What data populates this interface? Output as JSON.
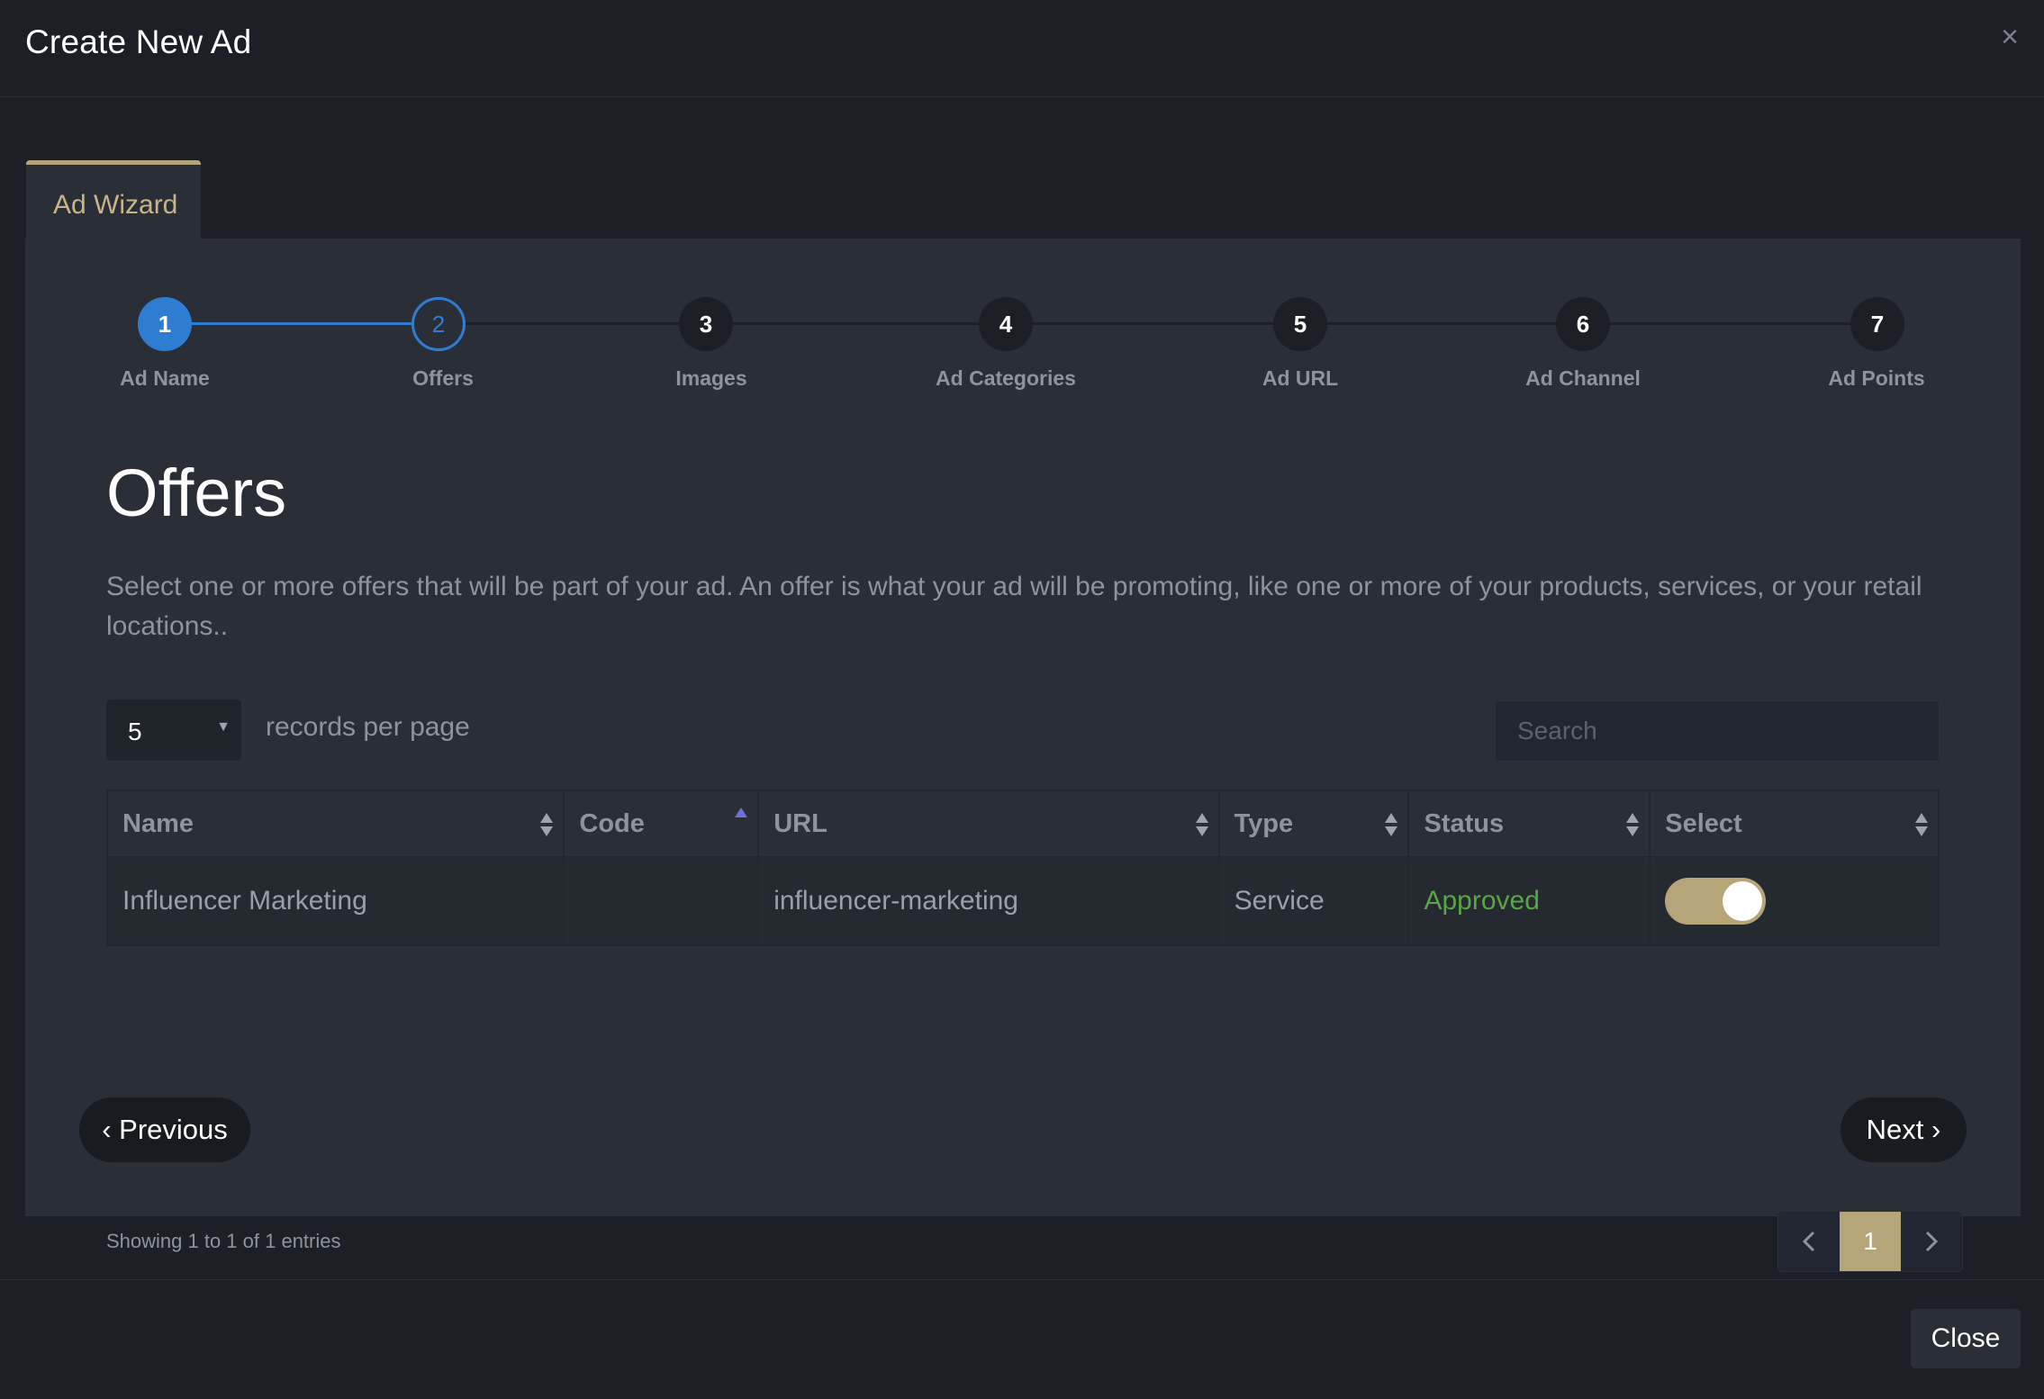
{
  "modal": {
    "title": "Create New Ad",
    "close_icon": "×",
    "tab_label": "Ad Wizard"
  },
  "stepper": {
    "steps": [
      {
        "number": "1",
        "label": "Ad Name",
        "state": "done"
      },
      {
        "number": "2",
        "label": "Offers",
        "state": "current"
      },
      {
        "number": "3",
        "label": "Images",
        "state": "pending"
      },
      {
        "number": "4",
        "label": "Ad Categories",
        "state": "pending"
      },
      {
        "number": "5",
        "label": "Ad URL",
        "state": "pending"
      },
      {
        "number": "6",
        "label": "Ad Channel",
        "state": "pending"
      },
      {
        "number": "7",
        "label": "Ad Points",
        "state": "pending"
      }
    ]
  },
  "offers": {
    "title": "Offers",
    "description": "Select one or more offers that will be part of your ad. An offer is what your ad will be promoting, like one or more of your products, services, or your retail locations.."
  },
  "table_controls": {
    "per_page_value": "5",
    "per_page_label": "records per page",
    "search_placeholder": "Search"
  },
  "table": {
    "columns": [
      "Name",
      "Code",
      "URL",
      "Type",
      "Status",
      "Select"
    ],
    "rows": [
      {
        "name": "Influencer Marketing",
        "code": "",
        "url": "influencer-marketing",
        "type": "Service",
        "status": "Approved",
        "selected": true
      }
    ]
  },
  "pagination": {
    "showing": "Showing 1 to 1 of 1 entries",
    "current_page": "1"
  },
  "nav": {
    "previous_label": "‹ Previous",
    "next_label": "Next ›"
  },
  "footer": {
    "close_label": "Close"
  },
  "colors": {
    "accent_blue": "#2f7dd3",
    "accent_gold": "#b5a579",
    "status_approved": "#5aa544"
  }
}
